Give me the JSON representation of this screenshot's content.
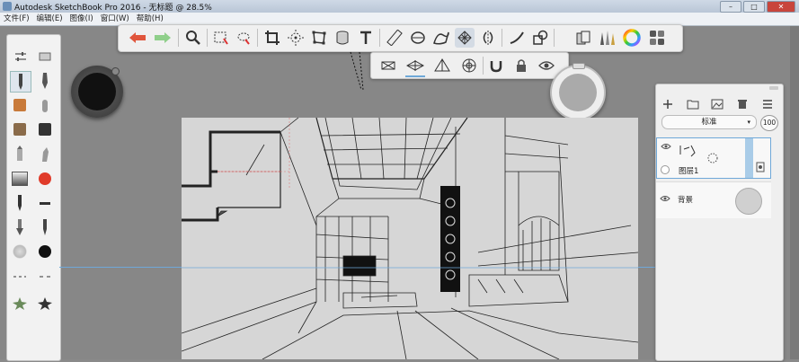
{
  "window": {
    "title": "Autodesk SketchBook Pro 2016 - 无标题 @ 28.5%",
    "buttons": [
      "–",
      "□",
      "✕"
    ]
  },
  "menu": [
    "文件(F)",
    "编辑(E)",
    "图像(I)",
    "窗口(W)",
    "帮助(H)"
  ],
  "toolbar": {
    "icons": [
      "undo-icon",
      "redo-icon",
      "zoom-icon",
      "select-icon",
      "lasso-icon",
      "crop-icon",
      "transform-icon",
      "distort-icon",
      "cylinder-icon",
      "text-icon",
      "ruler-icon",
      "ellipse-guide-icon",
      "french-curve-icon",
      "perspective-guide-icon",
      "symmetry-icon",
      "stroke-icon",
      "shape-icon",
      "copy-paste-icon",
      "brush-library-icon",
      "color-wheel-icon",
      "swatches-icon"
    ]
  },
  "subbar": {
    "icons": [
      "one-point-perspective-icon",
      "two-point-perspective-icon",
      "three-point-perspective-icon",
      "fisheye-icon",
      "magnet-icon",
      "lock-icon",
      "visibility-icon"
    ]
  },
  "layers": {
    "blend_mode": "标准",
    "opacity": "100",
    "layer1_name": "图层1",
    "background_name": "背景"
  },
  "colors": {
    "accent": "#6fa8d8",
    "canvas": "#d6d6d6",
    "undo": "#e0553c",
    "redo": "#8fcf8a",
    "brush_red": "#e03b2a"
  }
}
